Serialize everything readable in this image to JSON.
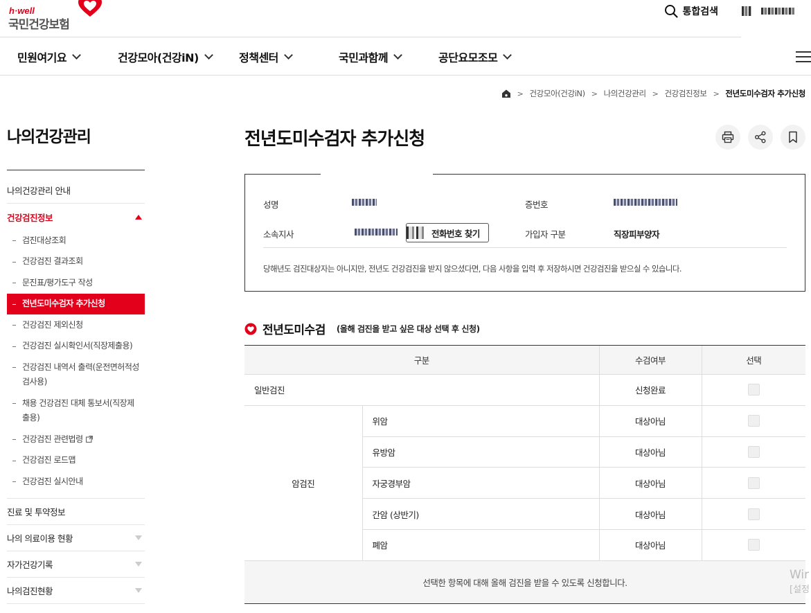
{
  "brand": {
    "tagline": "h·well",
    "name": "국민건강보험",
    "accent": "#e2001a"
  },
  "header": {
    "search_label": "통합검색"
  },
  "gnb": [
    {
      "label": "민원여기요"
    },
    {
      "label": "건강모아(건강iN)"
    },
    {
      "label": "정책센터"
    },
    {
      "label": "국민과함께"
    },
    {
      "label": "공단요모조모"
    }
  ],
  "breadcrumb": [
    "건강모아(건강iN)",
    "나의건강관리",
    "건강검진정보",
    "전년도미수검자 추가신청"
  ],
  "sidebar": {
    "title": "나의건강관리",
    "top_item": "나의건강관리 안내",
    "active_group": "건강검진정보",
    "sub_items": [
      "검진대상조회",
      "건강검진 결과조회",
      "문진표/평가도구 작성",
      "전년도미수검자 추가신청",
      "건강검진 제외신청",
      "건강검진 실시확인서(직장제출용)",
      "건강검진 내역서 출력(운전면허적성검사용)",
      "채용 건강검진 대체 통보서(직장제출용)",
      "건강검진 관련법령",
      "건강검진 로드맵",
      "건강검진 실시안내"
    ],
    "other_groups": [
      "진료 및 투약정보",
      "나의 의료이용 현황",
      "자가건강기록",
      "나의검진현황"
    ]
  },
  "page": {
    "title": "전년도미수검자 추가신청"
  },
  "info": {
    "name_label": "성명",
    "card_label": "증번호",
    "branch_label": "소속지사",
    "find_button": "전화번호 찾기",
    "member_type_label": "가입자 구분",
    "member_type_value": "직장피부양자",
    "note": "당해년도 검진대상자는 아니지만, 전년도 건강검진을 받지 않으셨다면, 다음 사항을 입력 후 저장하시면 건강검진을 받으실 수 있습니다."
  },
  "section": {
    "title": "전년도미수검",
    "subtitle": "(올해 검진을 받고 싶은 대상 선택 후 신청)"
  },
  "table": {
    "headers": [
      "구분",
      "수검여부",
      "선택"
    ],
    "general": {
      "label": "일반검진",
      "status": "신청완료"
    },
    "cancer_group": "암검진",
    "cancer_rows": [
      {
        "label": "위암",
        "status": "대상아님"
      },
      {
        "label": "유방암",
        "status": "대상아님"
      },
      {
        "label": "자궁경부암",
        "status": "대상아님"
      },
      {
        "label": "간암 (상반기)",
        "status": "대상아님"
      },
      {
        "label": "폐암",
        "status": "대상아님"
      }
    ],
    "footer": "선택한 항목에 대해 올해 검진을 받을 수 있도록 신청합니다."
  },
  "watermark": {
    "line1": "Wir",
    "line2": "[설정"
  }
}
